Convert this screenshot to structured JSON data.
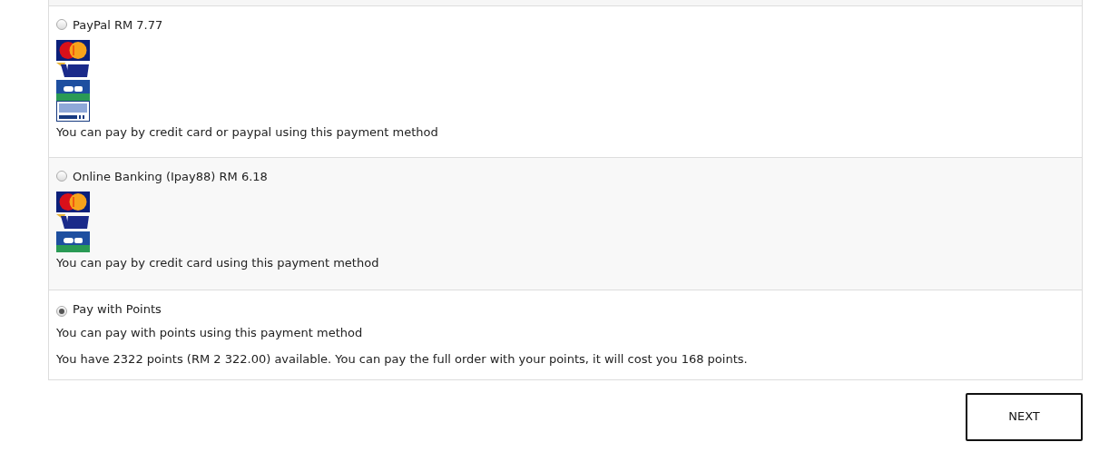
{
  "payment_methods": [
    {
      "label": "PayPal RM 7.77",
      "selected": false,
      "logos": [
        {
          "kind": "mastercard"
        },
        {
          "kind": "visa"
        },
        {
          "kind": "cb"
        },
        {
          "kind": "paypal"
        }
      ],
      "description": "You can pay by credit card or paypal using this payment method"
    },
    {
      "label": "Online Banking (Ipay88) RM 6.18",
      "selected": false,
      "logos": [
        {
          "kind": "mastercard"
        },
        {
          "kind": "visa"
        },
        {
          "kind": "cb"
        }
      ],
      "description": "You can pay by credit card using this payment method"
    },
    {
      "label": "Pay with Points",
      "selected": true,
      "description": "You can pay with points using this payment method",
      "note": "You have 2322 points (RM 2 322.00) available. You can pay the full order with your points, it will cost you 168 points."
    }
  ],
  "next_button": "NEXT"
}
